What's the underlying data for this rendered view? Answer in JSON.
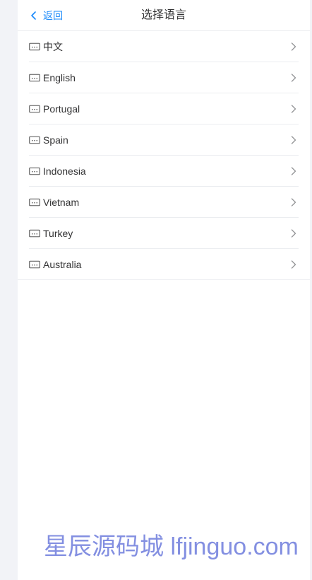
{
  "nav": {
    "back_label": "返回",
    "title": "选择语言"
  },
  "languages": [
    {
      "label": "中文"
    },
    {
      "label": "English"
    },
    {
      "label": "Portugal"
    },
    {
      "label": "Spain"
    },
    {
      "label": "Indonesia"
    },
    {
      "label": "Vietnam"
    },
    {
      "label": "Turkey"
    },
    {
      "label": "Australia"
    }
  ],
  "watermark": "星辰源码城 lfjinguo.com",
  "colors": {
    "accent": "#1989fa",
    "text": "#323233",
    "divider": "#ebedf0",
    "watermark": "#7d8ae0"
  },
  "icons": {
    "back": "chevron-left-icon",
    "item": "keyboard-icon",
    "item_arrow": "chevron-right-icon"
  }
}
